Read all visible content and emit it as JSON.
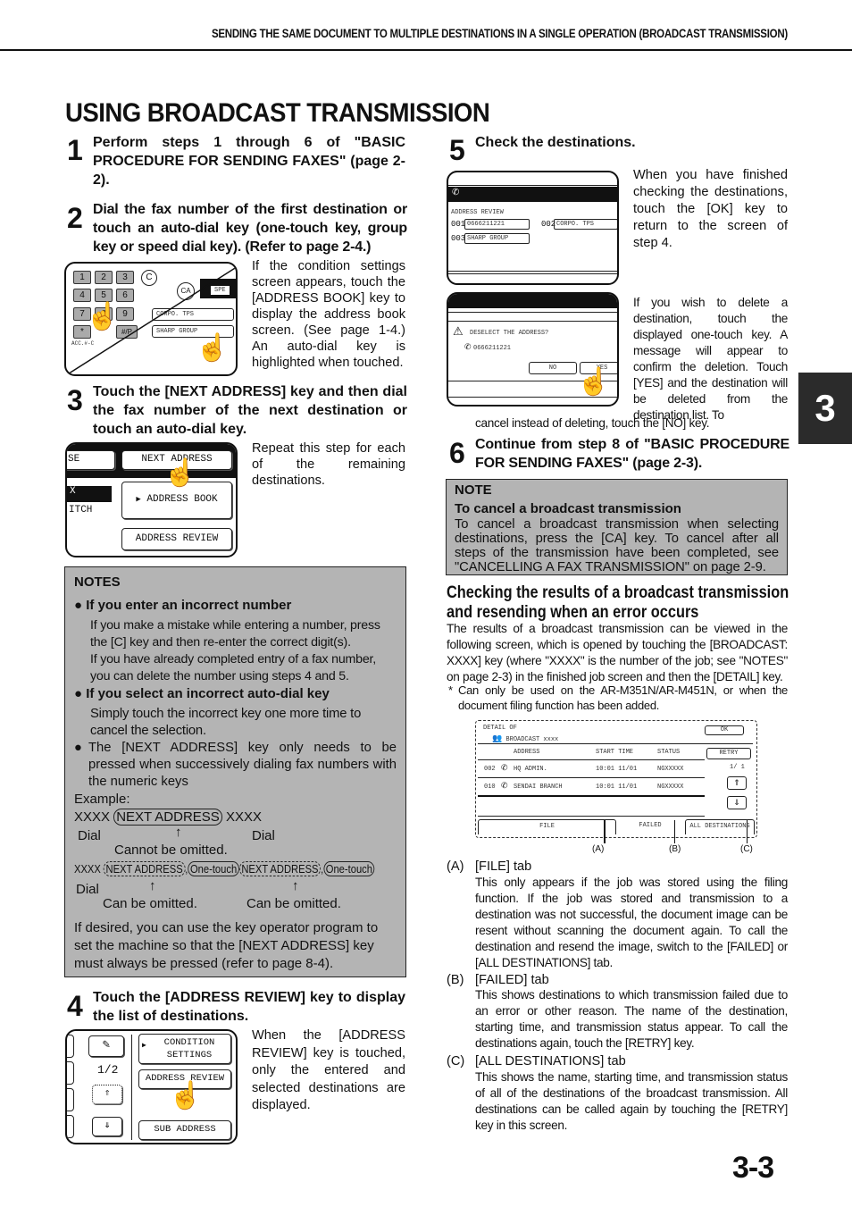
{
  "running_head": "SENDING THE SAME DOCUMENT TO MULTIPLE DESTINATIONS IN A SINGLE OPERATION (BROADCAST TRANSMISSION)",
  "page_title": "USING BROADCAST TRANSMISSION",
  "chapter_tab": "3",
  "page_number": "3-3",
  "steps": [
    {
      "num": "1",
      "text": "Perform steps 1 through 6 of \"BASIC PROCEDURE FOR SENDING FAXES\" (page 2-2)."
    },
    {
      "num": "2",
      "text": "Dial the fax number of the first destination or touch an auto-dial key (one-touch key, group key or speed dial key). (Refer to page 2-4.)",
      "desc": "If the condition settings screen appears, touch the [ADDRESS BOOK] key to display the address book screen. (See page 1-4.) An auto-dial key is highlighted when touched.",
      "screen": {
        "keys": [
          "1",
          "2",
          "3",
          "4",
          "5",
          "6",
          "7",
          "8",
          "9",
          "*",
          "#/P"
        ],
        "c_key": "C",
        "ca_key": "CA",
        "spe_label": "SPE",
        "acc_label": "ACC.#-C",
        "one_touch_1": "CORPO. TPS",
        "one_touch_2": "SHARP GROUP"
      }
    },
    {
      "num": "3",
      "text": "Touch the [NEXT ADDRESS] key and then dial the fax number of the next destination or touch an auto-dial key.",
      "desc": "Repeat this step for each of the remaining destinations.",
      "screen": {
        "left_top": "SE",
        "left_mid": "X",
        "left_bot": "ITCH",
        "next_address": "NEXT ADDRESS",
        "address_book": "ADDRESS BOOK",
        "address_review": "ADDRESS REVIEW"
      }
    },
    {
      "num": "4",
      "text": "Touch the [ADDRESS REVIEW] key to display the list of destinations.",
      "desc": "When the [ADDRESS REVIEW] key is touched, only the entered and selected destinations are displayed.",
      "screen": {
        "page": "1/2",
        "condition_settings": "CONDITION SETTINGS",
        "address_review": "ADDRESS REVIEW",
        "sub_address": "SUB ADDRESS"
      }
    },
    {
      "num": "5",
      "text": "Check the destinations.",
      "desc": "When you have finished checking the destinations, touch the [OK] key to return to the screen of step 4.",
      "desc2": "If you wish to delete a destination, touch the displayed one-touch key. A message will appear to confirm the deletion. Touch [YES] and the destination will be deleted from the destination list. To",
      "desc2_cont": "cancel instead of deleting, touch the [NO] key.",
      "review_screen": {
        "title": "ADDRESS REVIEW",
        "entries": [
          {
            "no": "001",
            "name": "0666211221"
          },
          {
            "no": "002",
            "name": "CORPO. TPS"
          },
          {
            "no": "003",
            "name": "SHARP GROUP"
          }
        ]
      },
      "confirm_screen": {
        "message": "DESELECT THE ADDRESS?",
        "number": "0666211221",
        "no": "NO",
        "yes": "YES"
      }
    },
    {
      "num": "6",
      "text": "Continue from step 8 of \"BASIC PROCEDURE FOR SENDING FAXES\" (page 2-3)."
    }
  ],
  "notes": {
    "title": "NOTES",
    "b1_head": "If you enter an incorrect number",
    "b1_p1": "If you make a mistake while entering a number, press the [C] key and then re-enter the correct digit(s).",
    "b1_p2": "If you have already completed entry of a fax number, you can delete the number using steps 4 and 5.",
    "b2_head": "If you select an incorrect auto-dial key",
    "b2_p": "Simply touch the incorrect key one more time to cancel the selection.",
    "b3_p": "The [NEXT ADDRESS] key only needs to be pressed when successively dialing fax numbers with the numeric keys",
    "example_label": "Example:",
    "ex1_xxxx": "XXXX",
    "ex1_next": "NEXT ADDRESS",
    "ex1_dial": "Dial",
    "ex1_cannot": "Cannot be omitted.",
    "ex2_next": "NEXT ADDRESS",
    "ex2_onetouch": "One-touch",
    "ex2_can": "Can be omitted.",
    "arrow": "↑",
    "closing": "If desired, you can use the key operator program to set the machine so that the [NEXT ADDRESS] key must always be pressed (refer to page 8-4)."
  },
  "note_cancel": {
    "title": "NOTE",
    "subtitle": "To cancel a broadcast transmission",
    "text": "To cancel a broadcast transmission when selecting destinations, press the [CA] key. To cancel after all steps of the transmission have been completed, see \"CANCELLING A FAX TRANSMISSION\" on page 2-9."
  },
  "checking": {
    "heading_1": "Checking the results of a broadcast transmission",
    "heading_2": "and resending when an error occurs",
    "intro": "The results of a broadcast transmission can be viewed in the following screen, which is opened by touching the [BROADCAST: XXXX] key (where \"XXXX\" is the number of the job; see \"NOTES\" on page 2-3) in the finished job screen and then the [DETAIL] key.",
    "footnote_mark": "*",
    "footnote": "Can only be used on the AR-M351N/AR-M451N, or when the document filing function has been added."
  },
  "detail_screen": {
    "title_1": "DETAIL OF",
    "title_2": "BROADCAST xxxx",
    "ok": "OK",
    "retry": "RETRY",
    "col_address": "ADDRESS",
    "col_start": "START TIME",
    "col_status": "STATUS",
    "page": "1/ 1",
    "rows": [
      {
        "no": "002",
        "name": "HQ ADMIN.",
        "time": "10:01  11/01",
        "status": "NGXXXXX"
      },
      {
        "no": "010",
        "name": "SENDAI BRANCH",
        "time": "10:01  11/01",
        "status": "NGXXXXX"
      }
    ],
    "tab_file": "FILE",
    "tab_failed": "FAILED",
    "tab_all": "ALL DESTINATIONS",
    "callouts": [
      "(A)",
      "(B)",
      "(C)"
    ]
  },
  "items": [
    {
      "label": "(A)",
      "title": "[FILE] tab",
      "text": "This only appears if the job was stored using the filing function. If the job was stored and transmission to a destination was not successful, the document image can be resent without scanning the document again. To call the destination and resend the image, switch to the [FAILED] or [ALL DESTINATIONS] tab."
    },
    {
      "label": "(B)",
      "title": "[FAILED] tab",
      "text": "This shows destinations to which transmission failed due to an error or other reason. The name of the destination, starting time, and transmission status appear. To call the destinations again, touch the [RETRY] key."
    },
    {
      "label": "(C)",
      "title": "[ALL DESTINATIONS] tab",
      "text": "This shows the name, starting time, and transmission status of all of the destinations of the broadcast transmission. All destinations can be called again by touching the [RETRY] key in this screen."
    }
  ],
  "icons": {
    "hand": "☝",
    "phone": "✆",
    "warning": "⚠",
    "up": "⇑",
    "down": "⇓",
    "triangle": "▶",
    "bullet": "●"
  }
}
